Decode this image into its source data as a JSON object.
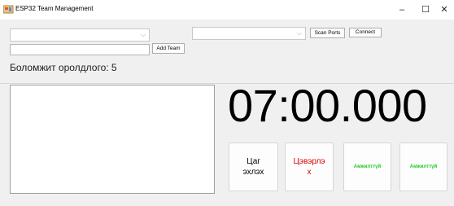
{
  "window": {
    "title": "ESP32 Team Management",
    "controls": {
      "minimize": "–",
      "maximize": "☐",
      "close": "✕"
    },
    "icon": "app-icon"
  },
  "toolbar": {
    "team_select": {
      "value": "",
      "chevron": "⌵"
    },
    "team_name_input": {
      "value": ""
    },
    "add_team_label": "Add Team",
    "port_select": {
      "value": "",
      "chevron": "⌵"
    },
    "scan_ports_label": "Scan Ports",
    "connect_label": "Connect"
  },
  "status": {
    "available_teams_label": "Боломжит оролдлого: 5"
  },
  "timer": {
    "display": "07:00.000"
  },
  "actions": {
    "start_line1": "Цаг",
    "start_line2": "эхлэх",
    "reset_line1": "Цэвэрлэ",
    "reset_line2": "х",
    "team1_label": "Амжилттүй",
    "team2_label": "Амжилттүй",
    "colors": {
      "reset": "#e00000",
      "team_status": "#22cc22"
    }
  }
}
